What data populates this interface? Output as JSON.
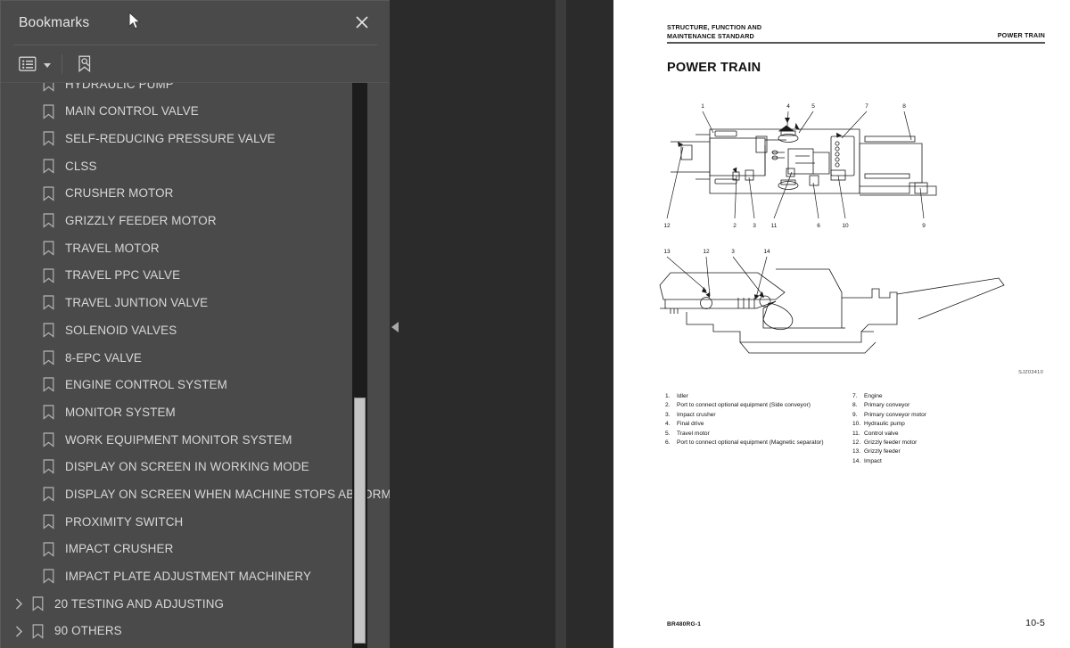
{
  "sidebar": {
    "title": "Bookmarks",
    "close_icon": "close-icon",
    "toolbar": {
      "options_icon": "list-options-icon",
      "options_caret": "chevron-down-icon",
      "find_bookmark_icon": "find-bookmark-icon"
    },
    "items": [
      {
        "label": "HYDRAULIC PUMP",
        "level": 1,
        "expandable": false,
        "clipped": true
      },
      {
        "label": "MAIN CONTROL VALVE",
        "level": 1,
        "expandable": false
      },
      {
        "label": "SELF-REDUCING PRESSURE VALVE",
        "level": 1,
        "expandable": false
      },
      {
        "label": "CLSS",
        "level": 1,
        "expandable": false
      },
      {
        "label": "CRUSHER MOTOR",
        "level": 1,
        "expandable": false
      },
      {
        "label": "GRIZZLY FEEDER MOTOR",
        "level": 1,
        "expandable": false
      },
      {
        "label": "TRAVEL MOTOR",
        "level": 1,
        "expandable": false
      },
      {
        "label": "TRAVEL PPC VALVE",
        "level": 1,
        "expandable": false
      },
      {
        "label": "TRAVEL JUNTION VALVE",
        "level": 1,
        "expandable": false
      },
      {
        "label": "SOLENOID VALVES",
        "level": 1,
        "expandable": false
      },
      {
        "label": "8-EPC VALVE",
        "level": 1,
        "expandable": false
      },
      {
        "label": "ENGINE CONTROL SYSTEM",
        "level": 1,
        "expandable": false
      },
      {
        "label": "MONITOR SYSTEM",
        "level": 1,
        "expandable": false
      },
      {
        "label": "WORK EQUIPMENT MONITOR SYSTEM",
        "level": 1,
        "expandable": false
      },
      {
        "label": "DISPLAY ON SCREEN IN WORKING MODE",
        "level": 1,
        "expandable": false
      },
      {
        "label": "DISPLAY ON SCREEN WHEN MACHINE STOPS ABNORMALLY",
        "level": 1,
        "expandable": false
      },
      {
        "label": "PROXIMITY SWITCH",
        "level": 1,
        "expandable": false
      },
      {
        "label": "IMPACT CRUSHER",
        "level": 1,
        "expandable": false
      },
      {
        "label": "IMPACT PLATE ADJUSTMENT MACHINERY",
        "level": 1,
        "expandable": false
      },
      {
        "label": "20 TESTING AND ADJUSTING",
        "level": 0,
        "expandable": true
      },
      {
        "label": "90 OTHERS",
        "level": 0,
        "expandable": true
      }
    ]
  },
  "viewer": {
    "collapse_handle_icon": "triangle-left-icon",
    "cursor_icon": "mouse-pointer-icon"
  },
  "page": {
    "header_left_line1": "STRUCTURE, FUNCTION AND",
    "header_left_line2": "MAINTENANCE STANDARD",
    "header_right": "POWER TRAIN",
    "title": "POWER TRAIN",
    "figure_code": "SJZ03410",
    "footer_doc": "BR480RG-1",
    "footer_page": "10-5",
    "legend_left": [
      {
        "num": "1.",
        "text": "Idler"
      },
      {
        "num": "2.",
        "text": "Port to connect optional equipment (Side conveyor)"
      },
      {
        "num": "3.",
        "text": "Impact crusher"
      },
      {
        "num": "4.",
        "text": "Final drive"
      },
      {
        "num": "5.",
        "text": "Travel motor"
      },
      {
        "num": "6.",
        "text": "Port to connect optional equipment (Magnetic separator)"
      }
    ],
    "legend_right": [
      {
        "num": "7.",
        "text": "Engine"
      },
      {
        "num": "8.",
        "text": "Primary conveyor"
      },
      {
        "num": "9.",
        "text": "Primary conveyor motor"
      },
      {
        "num": "10.",
        "text": "Hydraulic pump"
      },
      {
        "num": "11.",
        "text": "Control valve"
      },
      {
        "num": "12.",
        "text": "Grizzly feeder motor"
      },
      {
        "num": "13.",
        "text": "Grizzly feeder"
      },
      {
        "num": "14.",
        "text": "Impact"
      }
    ],
    "diagram_top_callouts": [
      "1",
      "4",
      "5",
      "7",
      "8",
      "12",
      "2",
      "3",
      "11",
      "6",
      "10",
      "9"
    ],
    "diagram_bottom_callouts": [
      "13",
      "12",
      "3",
      "14"
    ]
  },
  "colors": {
    "sidebar_bg": "#4a4a4a",
    "viewer_bg": "#2b2b2b",
    "page_bg": "#ffffff",
    "text": "#d8d8d8",
    "scroll_track": "#1c1c1c",
    "scroll_thumb": "#c4c4c4"
  }
}
